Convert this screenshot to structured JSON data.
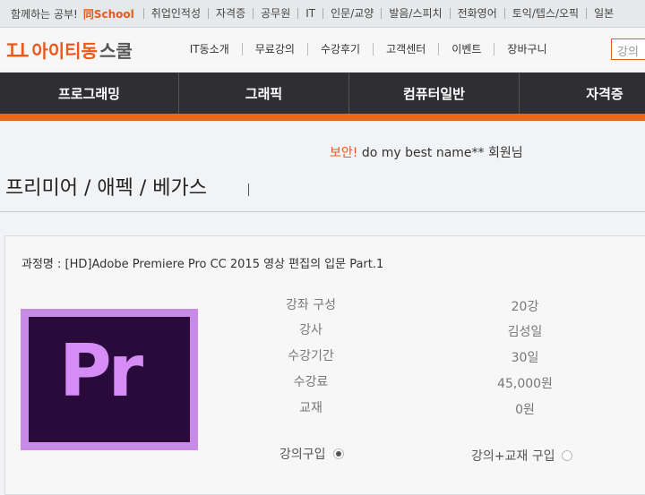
{
  "top_strip": {
    "tagline": "함께하는 공부!",
    "brand_small": "同School",
    "links": [
      "취업인적성",
      "자격증",
      "공무원",
      "IT",
      "인문/교양",
      "발음/스피치",
      "전화영어",
      "토익/텝스/오픽",
      "일본"
    ]
  },
  "header": {
    "logo_mark": "Ɪꓕ",
    "logo_text_1": "아이티동",
    "logo_text_2": "스쿨",
    "nav": [
      "IT동소개",
      "무료강의",
      "수강후기",
      "고객센터",
      "이벤트",
      "장바구니"
    ],
    "search_placeholder": "강의"
  },
  "categories": [
    "프로그래밍",
    "그래픽",
    "컴퓨터일반",
    "자격증"
  ],
  "user": {
    "security": "보안!",
    "motto": " do my best ",
    "name": "name**",
    "suffix": " 회원님"
  },
  "page_title": "프리미어 / 애펙 / 베가스",
  "course": {
    "title": "과정명 : [HD]Adobe Premiere Pro CC 2015 영상 편집의 입문 Part.1",
    "icon_text": "Pr",
    "details": [
      {
        "label": "강좌 구성",
        "value": "20강"
      },
      {
        "label": "강사",
        "value": "김성일"
      },
      {
        "label": "수강기간",
        "value": "30일"
      },
      {
        "label": "수강료",
        "value": "45,000원"
      },
      {
        "label": "교재",
        "value": "0원"
      }
    ],
    "purchase_options": [
      {
        "label": "강의구입",
        "selected": true
      },
      {
        "label": "강의+교재 구입",
        "selected": false
      }
    ]
  },
  "colors": {
    "accent": "#e8591a",
    "category_bg": "#2f2f33",
    "icon_bg": "#2a0a3b",
    "icon_border": "#c78be7"
  }
}
